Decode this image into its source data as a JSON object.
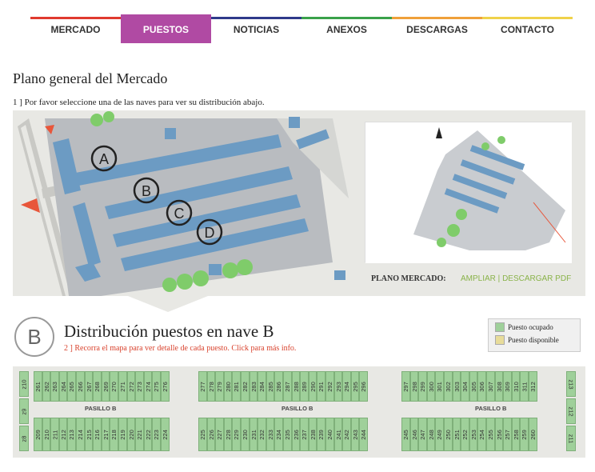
{
  "nav": [
    {
      "label": "MERCADO",
      "color": "#e03a2e",
      "active": false
    },
    {
      "label": "PUESTOS",
      "color": "#b04aa3",
      "active": true
    },
    {
      "label": "NOTICIAS",
      "color": "#2e3a8a",
      "active": false
    },
    {
      "label": "ANEXOS",
      "color": "#3aa14a",
      "active": false
    },
    {
      "label": "DESCARGAS",
      "color": "#f0a03a",
      "active": false
    },
    {
      "label": "CONTACTO",
      "color": "#f0d24a",
      "active": false
    }
  ],
  "page_title": "Plano general del Mercado",
  "step1": "1 ] Por favor seleccione una de las naves para ver su distribución abajo.",
  "map": {
    "naves": [
      "A",
      "B",
      "C",
      "D"
    ],
    "plano_label": "PLANO MERCADO:",
    "ampliar": "AMPLIAR",
    "separator": " | ",
    "descargar": "DESCARGAR PDF"
  },
  "section": {
    "letter": "B",
    "title": "Distribución puestos en nave B",
    "subtitle": "2 ] Recorra el mapa para ver detalle de cada puesto. Click para más info."
  },
  "legend": [
    {
      "label": "Puesto ocupado",
      "color": "#9fd09a"
    },
    {
      "label": "Puesto disponible",
      "color": "#e8dc9a"
    }
  ],
  "pasillo_label": "PASILLO B",
  "stalls": {
    "top_block1": [
      "261",
      "262",
      "263",
      "264",
      "265",
      "266",
      "267",
      "268",
      "269",
      "270",
      "271",
      "272",
      "273",
      "274",
      "275",
      "276"
    ],
    "top_block2": [
      "277",
      "278",
      "279",
      "280",
      "281",
      "282",
      "283",
      "284",
      "285",
      "286",
      "287",
      "288",
      "289",
      "290",
      "291",
      "292",
      "293",
      "294",
      "295",
      "296"
    ],
    "top_block3": [
      "297",
      "298",
      "299",
      "300",
      "301",
      "302",
      "303",
      "304",
      "305",
      "306",
      "307",
      "308",
      "309",
      "310",
      "311",
      "312"
    ],
    "bot_block1": [
      "209",
      "210",
      "211",
      "212",
      "213",
      "214",
      "215",
      "216",
      "217",
      "218",
      "219",
      "220",
      "221",
      "222",
      "223",
      "224"
    ],
    "bot_block2": [
      "225",
      "226",
      "227",
      "228",
      "229",
      "230",
      "231",
      "232",
      "233",
      "234",
      "235",
      "236",
      "237",
      "238",
      "239",
      "240",
      "241",
      "242",
      "243",
      "244"
    ],
    "bot_block3": [
      "245",
      "246",
      "247",
      "248",
      "249",
      "250",
      "251",
      "252",
      "253",
      "254",
      "255",
      "256",
      "257",
      "258",
      "259",
      "260"
    ],
    "left_side": [
      "z10",
      "z9",
      "z8"
    ],
    "right_side": [
      "z13",
      "z12",
      "z11"
    ]
  }
}
